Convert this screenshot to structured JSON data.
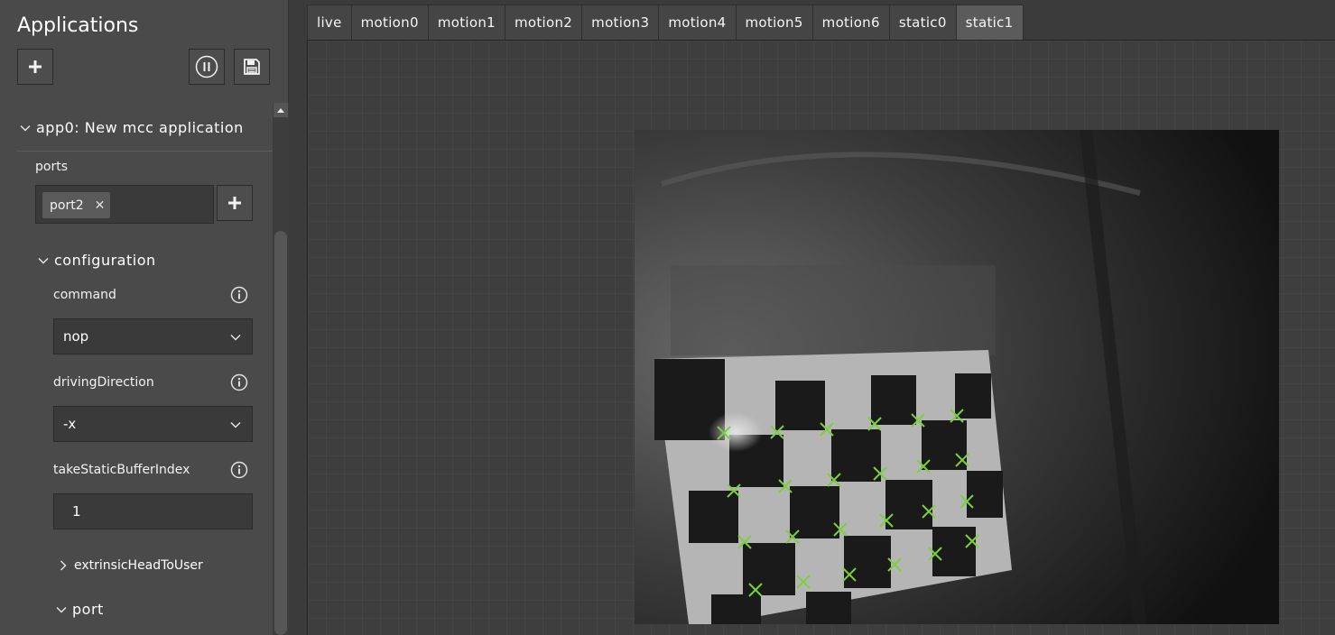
{
  "sidebar": {
    "title": "Applications",
    "add_button_icon": "plus-icon",
    "pause_button_icon": "pause-icon",
    "save_button_icon": "save-icon",
    "app": {
      "header": "app0: New mcc application",
      "ports_label": "ports",
      "port_tags": [
        {
          "label": "port2",
          "remove_icon": "close-icon"
        }
      ],
      "add_port_icon": "plus-icon",
      "configuration": {
        "header": "configuration",
        "command": {
          "label": "command",
          "value": "nop"
        },
        "driving_direction": {
          "label": "drivingDirection",
          "value": "-x"
        },
        "take_static_buffer_index": {
          "label": "takeStaticBufferIndex",
          "value": "1"
        },
        "extrinsic_head_to_user": {
          "label": "extrinsicHeadToUser"
        },
        "port": {
          "label": "port"
        }
      }
    }
  },
  "tabs": [
    {
      "label": "live",
      "active": false
    },
    {
      "label": "motion0",
      "active": false
    },
    {
      "label": "motion1",
      "active": false
    },
    {
      "label": "motion2",
      "active": false
    },
    {
      "label": "motion3",
      "active": false
    },
    {
      "label": "motion4",
      "active": false
    },
    {
      "label": "motion5",
      "active": false
    },
    {
      "label": "motion6",
      "active": false
    },
    {
      "label": "static0",
      "active": false
    },
    {
      "label": "static1",
      "active": true
    }
  ],
  "colors": {
    "marker": "#7ad13a",
    "active_tab": "#5b5b5b"
  }
}
